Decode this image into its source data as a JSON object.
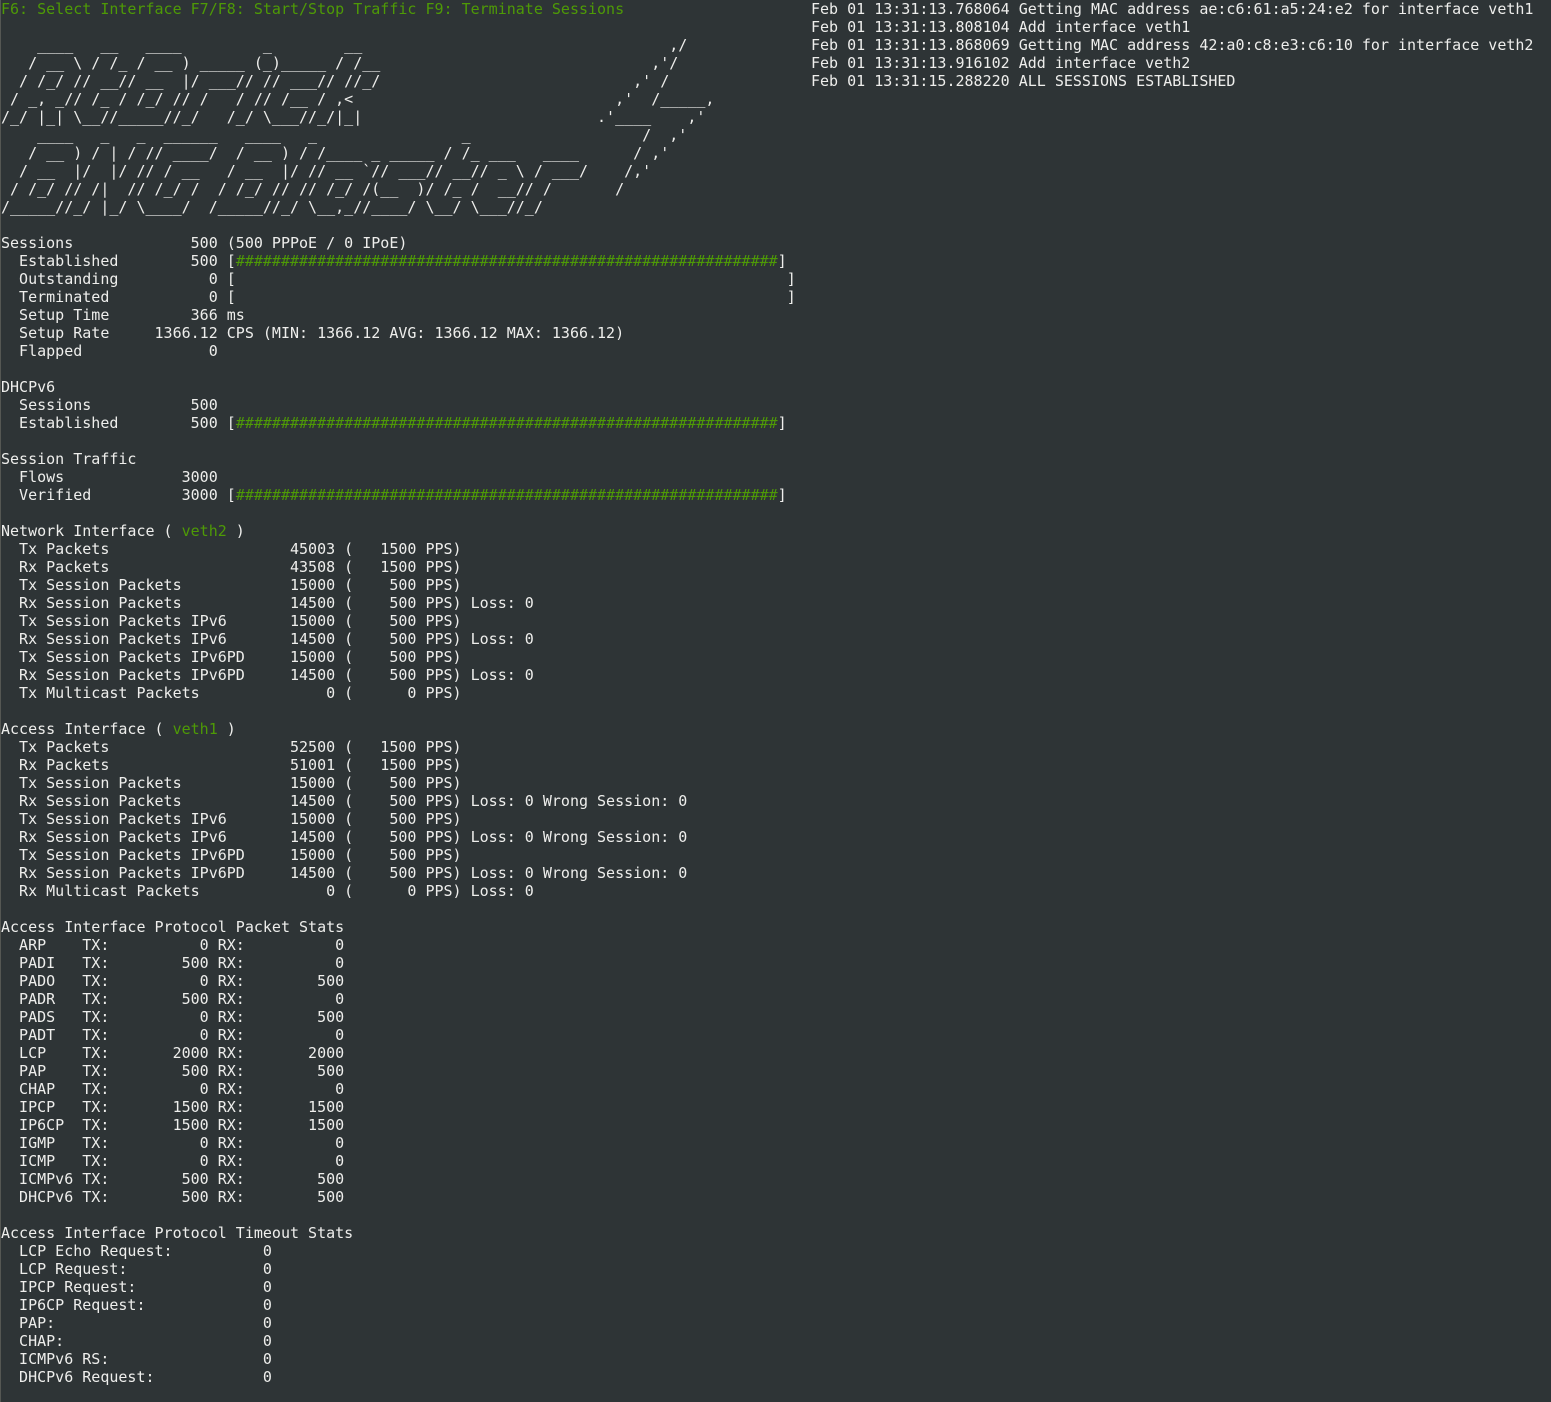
{
  "keys_hint": "F6: Select Interface F7/F8: Start/Stop Traffic F9: Terminate Sessions",
  "banner_lines": [
    "    ____   __   ____         _        __                                  ,/",
    "   / __ \\ / /_ / __ ) _____ (_)_____ / /__                              ,'/",
    "  / /_/ // __// __  |/ ___// // ___// //_/                            ,' /",
    " / _, _// /_ / /_/ // /   / // /__ / ,<                             ,'  /_____,",
    "/_/ |_| \\__//_____//_/   /_/ \\___//_/|_|                          .'____    ,'",
    "    ____   _   _  ______   ____   _                _                   /  ,'",
    "   / __ ) / | / // ____/  / __ ) / /____ _ _____ / /_ ___   ____      / ,'",
    "  / __  |/  |/ // / __   / __  |/ // __ `// ___// __// _ \\ / ___/    /,'",
    " / /_/ // /|  // /_/ /  / /_/ // // /_/ /(__  )/ /_ /  __// /       /",
    "/_____//_/ |_/ \\____/  /_____//_/ \\__,_//____/ \\__/ \\___//_/"
  ],
  "log": [
    "Feb 01 13:31:13.768064 Getting MAC address ae:c6:61:a5:24:e2 for interface veth1",
    "Feb 01 13:31:13.808104 Add interface veth1",
    "Feb 01 13:31:13.868069 Getting MAC address 42:a0:c8:e3:c6:10 for interface veth2",
    "Feb 01 13:31:13.916102 Add interface veth2",
    "Feb 01 13:31:15.288220 ALL SESSIONS ESTABLISHED"
  ],
  "sessions": {
    "header": "Sessions             500 (500 PPPoE / 0 IPoE)",
    "established_label": "  Established        500 ",
    "established_bar": "############################################################",
    "established_bar_fraction": 1.0,
    "outstanding_label": "  Outstanding          0 ",
    "outstanding_bar": "                                                             ",
    "outstanding_bar_fraction": 0.0,
    "terminated_label": "  Terminated           0 ",
    "terminated_bar": "                                                             ",
    "terminated_bar_fraction": 0.0,
    "setup_time": "  Setup Time         366 ms",
    "setup_rate": "  Setup Rate     1366.12 CPS (MIN: 1366.12 AVG: 1366.12 MAX: 1366.12)",
    "flapped": "  Flapped              0"
  },
  "dhcpv6": {
    "header": "DHCPv6",
    "sessions": "  Sessions           500",
    "established_label": "  Established        500 ",
    "established_bar": "############################################################",
    "established_bar_fraction": 1.0
  },
  "session_traffic": {
    "header": "Session Traffic",
    "flows": "  Flows             3000",
    "verified_label": "  Verified          3000 ",
    "verified_bar": "############################################################",
    "verified_bar_fraction": 1.0
  },
  "network_interface": {
    "header_prefix": "Network Interface ( ",
    "interface_name": "veth2",
    "header_suffix": " )",
    "rows": [
      "  Tx Packets                    45003 (   1500 PPS)",
      "  Rx Packets                    43508 (   1500 PPS)",
      "  Tx Session Packets            15000 (    500 PPS)",
      "  Rx Session Packets            14500 (    500 PPS) Loss: 0",
      "  Tx Session Packets IPv6       15000 (    500 PPS)",
      "  Rx Session Packets IPv6       14500 (    500 PPS) Loss: 0",
      "  Tx Session Packets IPv6PD     15000 (    500 PPS)",
      "  Rx Session Packets IPv6PD     14500 (    500 PPS) Loss: 0",
      "  Tx Multicast Packets              0 (      0 PPS)"
    ]
  },
  "access_interface": {
    "header_prefix": "Access Interface ( ",
    "interface_name": "veth1",
    "header_suffix": " )",
    "rows": [
      "  Tx Packets                    52500 (   1500 PPS)",
      "  Rx Packets                    51001 (   1500 PPS)",
      "  Tx Session Packets            15000 (    500 PPS)",
      "  Rx Session Packets            14500 (    500 PPS) Loss: 0 Wrong Session: 0",
      "  Tx Session Packets IPv6       15000 (    500 PPS)",
      "  Rx Session Packets IPv6       14500 (    500 PPS) Loss: 0 Wrong Session: 0",
      "  Tx Session Packets IPv6PD     15000 (    500 PPS)",
      "  Rx Session Packets IPv6PD     14500 (    500 PPS) Loss: 0 Wrong Session: 0",
      "  Rx Multicast Packets              0 (      0 PPS) Loss: 0"
    ]
  },
  "protocol_stats": {
    "header": "Access Interface Protocol Packet Stats",
    "rows": [
      "  ARP    TX:          0 RX:          0",
      "  PADI   TX:        500 RX:          0",
      "  PADO   TX:          0 RX:        500",
      "  PADR   TX:        500 RX:          0",
      "  PADS   TX:          0 RX:        500",
      "  PADT   TX:          0 RX:          0",
      "  LCP    TX:       2000 RX:       2000",
      "  PAP    TX:        500 RX:        500",
      "  CHAP   TX:          0 RX:          0",
      "  IPCP   TX:       1500 RX:       1500",
      "  IP6CP  TX:       1500 RX:       1500",
      "  IGMP   TX:          0 RX:          0",
      "  ICMP   TX:          0 RX:          0",
      "  ICMPv6 TX:        500 RX:        500",
      "  DHCPv6 TX:        500 RX:        500"
    ]
  },
  "timeout_stats": {
    "header": "Access Interface Protocol Timeout Stats",
    "rows": [
      "  LCP Echo Request:          0",
      "  LCP Request:               0",
      "  IPCP Request:              0",
      "  IP6CP Request:             0",
      "  PAP:                       0",
      "  CHAP:                      0",
      "  ICMPv6 RS:                 0",
      "  DHCPv6 Request:            0"
    ]
  },
  "colors": {
    "background": "#2e3436",
    "foreground": "#eeeeec",
    "accent_green": "#4e9a06"
  }
}
